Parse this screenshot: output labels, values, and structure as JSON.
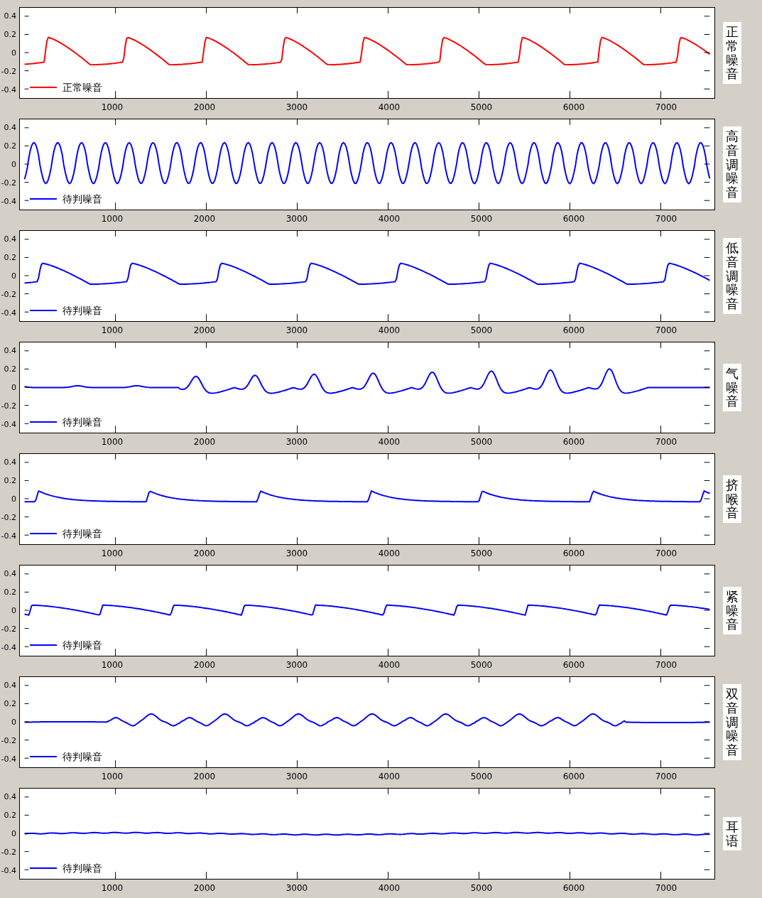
{
  "panels": [
    {
      "kind": "normal",
      "side_label": "正常噪音",
      "legend": "正常噪音",
      "color": "#ff0000",
      "y_ticks": [
        "0.4",
        "0.2",
        "0",
        "-0.2",
        "-0.4"
      ],
      "x_ticks": [
        "1000",
        "2000",
        "3000",
        "4000",
        "5000",
        "6000",
        "7000"
      ]
    },
    {
      "kind": "high-pitch",
      "side_label": "高音调噪音",
      "legend": "待判噪音",
      "color": "#0000ff",
      "y_ticks": [
        "0.4",
        "0.2",
        "0",
        "-0.2",
        "-0.4"
      ],
      "x_ticks": [
        "1000",
        "2000",
        "3000",
        "4000",
        "5000",
        "6000",
        "7000"
      ]
    },
    {
      "kind": "low-pitch",
      "side_label": "低音调噪音",
      "legend": "待判噪音",
      "color": "#0000ff",
      "y_ticks": [
        "0.4",
        "0.2",
        "0",
        "-0.2",
        "-0.4"
      ],
      "x_ticks": [
        "1000",
        "2000",
        "3000",
        "4000",
        "5000",
        "6000",
        "7000"
      ]
    },
    {
      "kind": "breathy",
      "side_label": "气噪音",
      "legend": "待判噪音",
      "color": "#0000ff",
      "y_ticks": [
        "0.4",
        "0.2",
        "0",
        "-0.2",
        "-0.4"
      ],
      "x_ticks": [
        "1000",
        "2000",
        "3000",
        "4000",
        "5000",
        "6000",
        "7000"
      ]
    },
    {
      "kind": "pressed",
      "side_label": "挤喉音",
      "legend": "待判噪音",
      "color": "#0000ff",
      "y_ticks": [
        "0.4",
        "0.2",
        "0",
        "-0.2",
        "-0.4"
      ],
      "x_ticks": [
        "1000",
        "2000",
        "3000",
        "4000",
        "5000",
        "6000",
        "7000"
      ]
    },
    {
      "kind": "tense",
      "side_label": "紧噪音",
      "legend": "待判噪音",
      "color": "#0000ff",
      "y_ticks": [
        "0.4",
        "0.2",
        "0",
        "-0.2",
        "-0.4"
      ],
      "x_ticks": [
        "1000",
        "2000",
        "3000",
        "4000",
        "5000",
        "6000",
        "7000"
      ]
    },
    {
      "kind": "diplophonic",
      "side_label": "双音调噪音",
      "legend": "待判噪音",
      "color": "#0000ff",
      "y_ticks": [
        "0.4",
        "0.2",
        "0",
        "-0.2",
        "-0.4"
      ],
      "x_ticks": [
        "1000",
        "2000",
        "3000",
        "4000",
        "5000",
        "6000",
        "7000"
      ]
    },
    {
      "kind": "whisper",
      "side_label": "耳语",
      "legend": "待判噪音",
      "color": "#0000ff",
      "y_ticks": [
        "0.4",
        "0.2",
        "0",
        "-0.2",
        "-0.4"
      ],
      "x_ticks": [
        "1000",
        "2000",
        "3000",
        "4000",
        "5000",
        "6000",
        "7000"
      ]
    }
  ]
}
